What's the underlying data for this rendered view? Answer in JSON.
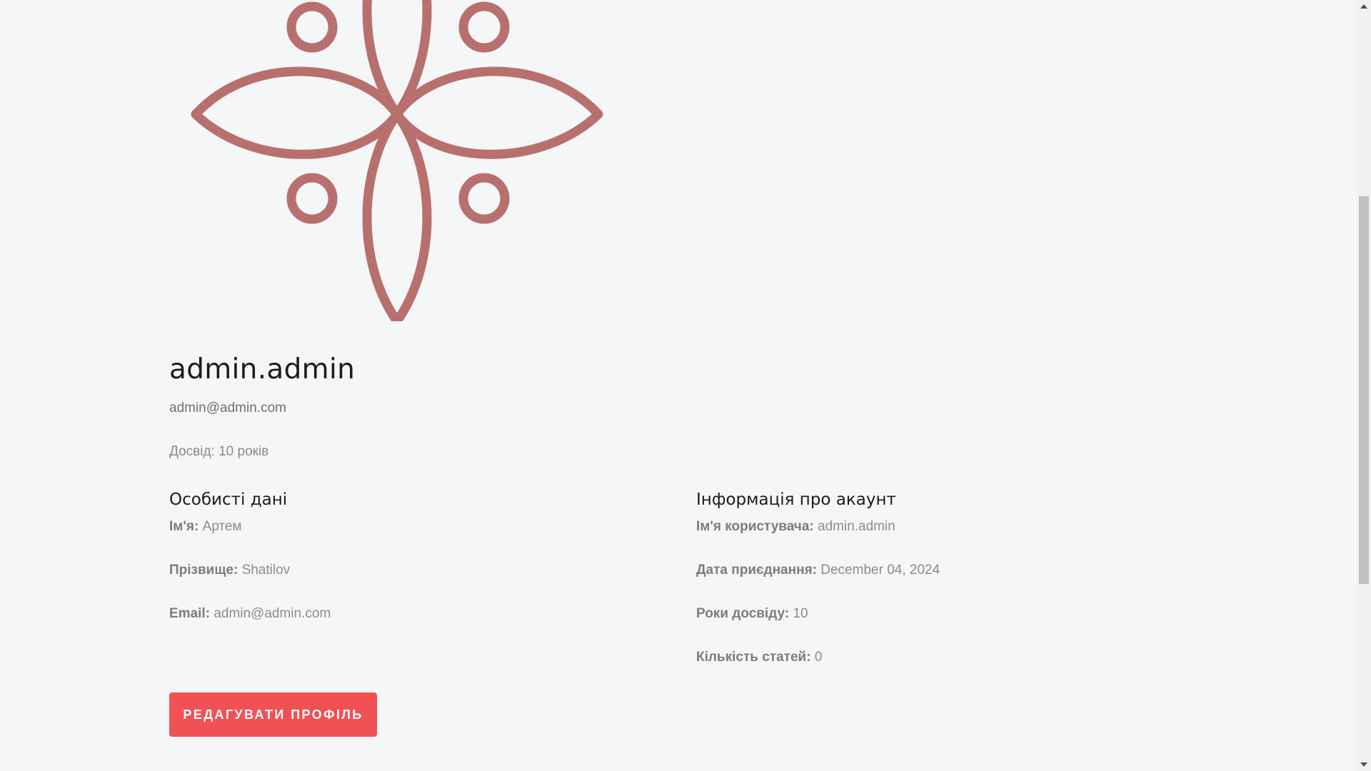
{
  "profile": {
    "username": "admin.admin",
    "email": "admin@admin.com",
    "experience_text": "Досвід: 10 років"
  },
  "personal": {
    "title": "Особисті дані",
    "first_name_label": "Ім'я:",
    "first_name": "Артем",
    "last_name_label": "Прізвище:",
    "last_name": "Shatilov",
    "email_label": "Email:",
    "email": "admin@admin.com"
  },
  "account": {
    "title": "Інформація про акаунт",
    "username_label": "Ім'я користувача:",
    "username": "admin.admin",
    "join_date_label": "Дата приєднання:",
    "join_date": "December 04, 2024",
    "years_label": "Роки досвіду:",
    "years": "10",
    "articles_label": "Кількість статей:",
    "articles": "0"
  },
  "actions": {
    "edit_label": "РЕДАГУВАТИ ПРОФІЛЬ"
  },
  "colors": {
    "logo": "#b8706f",
    "accent": "#f05155",
    "background": "#f5f6f8"
  },
  "icons": {
    "logo": "flower-logo-icon"
  }
}
